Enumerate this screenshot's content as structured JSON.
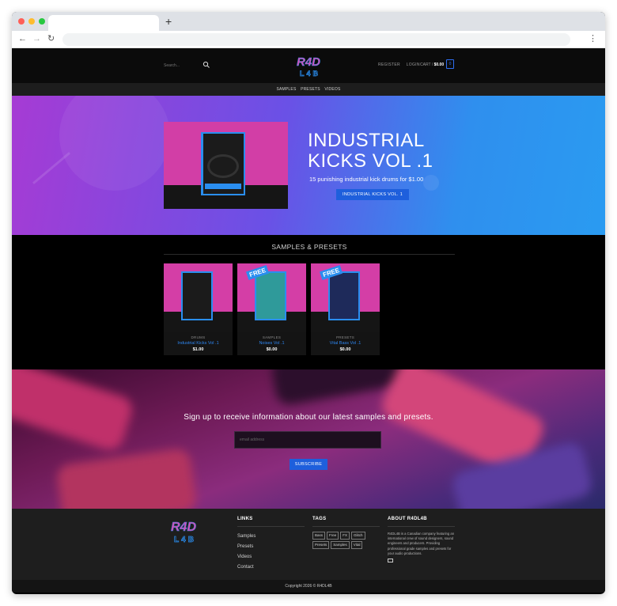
{
  "browser": {
    "new_tab_label": "+",
    "back_icon": "back-arrow-icon",
    "forward_icon": "forward-arrow-icon",
    "reload_icon": "reload-icon",
    "menu_icon": "kebab-icon"
  },
  "header": {
    "search_placeholder": "Search...",
    "logo_top": "R4D",
    "logo_bottom": "L4B",
    "register": "REGISTER",
    "login": "LOGIN",
    "cart_label": "CART /",
    "cart_total": "$0.00",
    "cart_count": "0"
  },
  "subnav": [
    "SAMPLES",
    "PRESETS",
    "VIDEOS"
  ],
  "hero": {
    "title_line1": "INDUSTRIAL",
    "title_line2": "KICKS VOL .1",
    "subtitle": "15 punishing industrial kick drums for $1.00",
    "button": "INDUSTRIAL KICKS VOL. 1"
  },
  "products_section": {
    "title": "SAMPLES & PRESETS",
    "items": [
      {
        "category": "DRUMS",
        "name": "Industrial Kicks Vol .1",
        "price": "$1.00",
        "badge": ""
      },
      {
        "category": "SAMPLES",
        "name": "Noises Vol .1",
        "price": "$0.00",
        "badge": "FREE"
      },
      {
        "category": "PRESETS",
        "name": "Vital Bass Vol .1",
        "price": "$0.00",
        "badge": "FREE"
      }
    ]
  },
  "newsletter": {
    "title": "Sign up to receive information about our latest samples and presets.",
    "placeholder": "email address",
    "button": "SUBSCRIBE"
  },
  "footer": {
    "links_head": "LINKS",
    "links": [
      "Samples",
      "Presets",
      "Videos",
      "Contact"
    ],
    "tags_head": "TAGS",
    "tags": [
      "Bass",
      "Free",
      "FX",
      "Glitch",
      "Presets",
      "Samples",
      "Vital"
    ],
    "about_head": "ABOUT R4DL4B",
    "about_text": "R4DL4B is a Canadian company featuring an international crew of sound designers, sound engineers and producers. Providing professional grade samples and presets for your audio productions.",
    "copyright": "Copyright 2026 © R4DL4B"
  },
  "colors": {
    "accent_blue": "#1e5fdc",
    "brand_pink": "#d43ea6",
    "link_blue": "#2e86f0"
  }
}
